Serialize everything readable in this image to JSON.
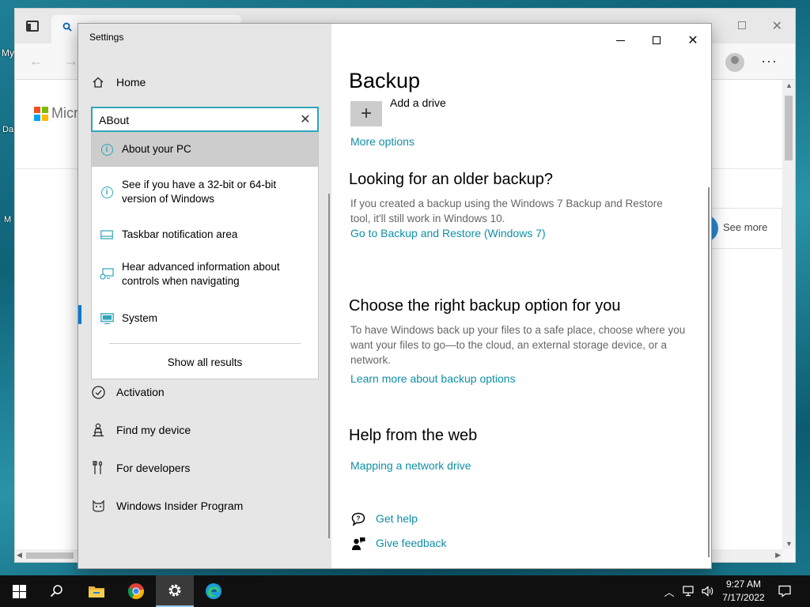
{
  "desktop": {
    "fragments": [
      "My",
      "Da",
      "M"
    ]
  },
  "browser": {
    "ms_brand": "Micro",
    "see_more": "See more",
    "logo_colors": [
      "#f25022",
      "#7fba00",
      "#00a4ef",
      "#ffb900"
    ]
  },
  "settings": {
    "window_title": "Settings",
    "home_label": "Home",
    "search": {
      "value": "ABout",
      "clear_icon": "close-icon"
    },
    "suggestions": [
      {
        "label": "About your PC",
        "icon": "info-icon",
        "selected": true
      },
      {
        "label": "See if you have a 32-bit or 64-bit version of Windows",
        "icon": "info-icon",
        "selected": false
      },
      {
        "label": "Taskbar notification area",
        "icon": "taskbar-icon",
        "selected": false
      },
      {
        "label": "Hear advanced information about controls when navigating",
        "icon": "narrator-icon",
        "selected": false
      },
      {
        "label": "System",
        "icon": "monitor-icon",
        "selected": false
      }
    ],
    "show_all": "Show all results",
    "nav_items": [
      {
        "label": "Activation",
        "icon": "check-circle-icon"
      },
      {
        "label": "Find my device",
        "icon": "person-location-icon"
      },
      {
        "label": "For developers",
        "icon": "tools-icon"
      },
      {
        "label": "Windows Insider Program",
        "icon": "cat-icon"
      }
    ],
    "accent_color": "#0f8fa8"
  },
  "main": {
    "title": "Backup",
    "add_drive": "Add a drive",
    "more_options": "More options",
    "older_backup": {
      "heading": "Looking for an older backup?",
      "text": "If you created a backup using the Windows 7 Backup and Restore tool, it'll still work in Windows 10.",
      "link": "Go to Backup and Restore (Windows 7)"
    },
    "choose": {
      "heading": "Choose the right backup option for you",
      "text": "To have Windows back up your files to a safe place, choose where you want your files to go—to the cloud, an external storage device, or a network.",
      "link": "Learn more about backup options"
    },
    "help_web": {
      "heading": "Help from the web",
      "link": "Mapping a network drive"
    },
    "get_help": "Get help",
    "give_feedback": "Give feedback"
  },
  "taskbar": {
    "time": "9:27 AM",
    "date": "7/17/2022",
    "apps": [
      "start-icon",
      "search-icon",
      "file-explorer-icon",
      "chrome-icon",
      "settings-gear-icon",
      "edge-icon"
    ]
  }
}
